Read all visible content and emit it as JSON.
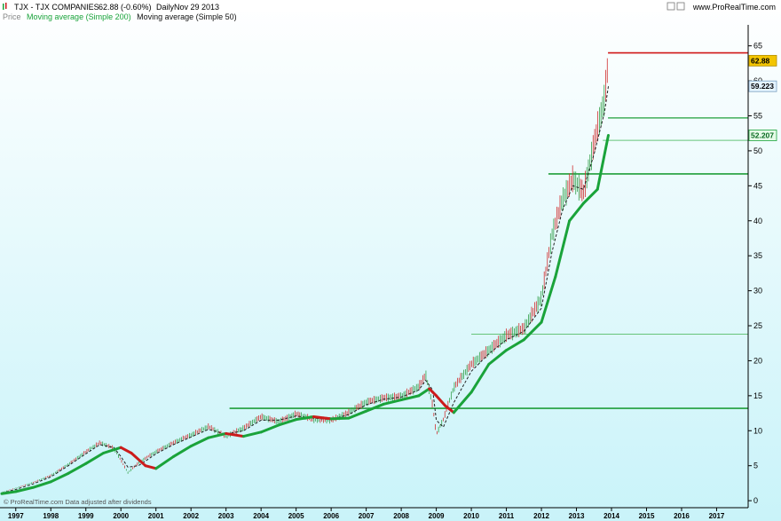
{
  "header": {
    "symbol": "TJX - TJX COMPANIES",
    "quote": "62.88 (-0.60%)",
    "period": "Daily",
    "date": "Nov 29 2013",
    "source": "www.ProRealTime.com"
  },
  "legend": {
    "price": "Price",
    "ma200": "Moving average (Simple 200)",
    "ma50": "Moving average (Simple 50)"
  },
  "watermark": "© ProRealTime.com Data adjusted after dividends",
  "colors": {
    "background_top": "#ffffff",
    "background_bottom": "#c9f3f9",
    "ma200_up": "#1aa33a",
    "ma200_down": "#cc1b1b",
    "ma50": "#222222",
    "price_up": "#33a04a",
    "price_down": "#d03030",
    "hline_strong": "#1f9e3a",
    "hline_light": "#66c47a",
    "hline_red": "#d01818",
    "badge_price": "#f3c500",
    "badge_ma50": "#e4f4ff",
    "badge_ma200": "#e6fbe8"
  },
  "chart_data": {
    "type": "line",
    "title": "TJX - TJX COMPANIES",
    "xlabel": "",
    "ylabel": "",
    "ylim": [
      -1,
      68
    ],
    "xlim": [
      1996.55,
      2017.9
    ],
    "y_ticks": [
      0,
      5,
      10,
      15,
      20,
      25,
      30,
      35,
      40,
      45,
      50,
      55,
      60,
      65
    ],
    "x_ticks": [
      "1997",
      "1998",
      "1999",
      "2000",
      "2001",
      "2002",
      "2003",
      "2004",
      "2005",
      "2006",
      "2007",
      "2008",
      "2009",
      "2010",
      "2011",
      "2012",
      "2013",
      "2014",
      "2015",
      "2016",
      "2017"
    ],
    "grid": false,
    "legend_position": "top-left",
    "series": [
      {
        "name": "Price",
        "x": [
          1996.6,
          1997.0,
          1997.5,
          1998.0,
          1998.5,
          1999.0,
          1999.4,
          1999.8,
          2000.0,
          2000.2,
          2000.5,
          2000.8,
          2001.0,
          2001.5,
          2002.0,
          2002.5,
          2003.0,
          2003.5,
          2004.0,
          2004.5,
          2005.0,
          2005.5,
          2006.0,
          2006.5,
          2007.0,
          2007.5,
          2008.0,
          2008.5,
          2008.7,
          2008.9,
          2009.0,
          2009.2,
          2009.5,
          2010.0,
          2010.5,
          2011.0,
          2011.5,
          2012.0,
          2012.3,
          2012.6,
          2012.9,
          2013.2,
          2013.5,
          2013.8,
          2013.91
        ],
        "values": [
          1.2,
          1.8,
          2.6,
          3.6,
          5.2,
          7.0,
          8.3,
          7.5,
          5.8,
          4.0,
          5.4,
          6.4,
          7.0,
          8.3,
          9.4,
          10.6,
          9.2,
          10.4,
          12.0,
          11.3,
          12.4,
          11.6,
          11.5,
          12.6,
          14.1,
          14.7,
          14.9,
          16.3,
          18.0,
          13.5,
          9.5,
          11.6,
          16.2,
          19.5,
          21.5,
          23.6,
          24.6,
          29.0,
          38.0,
          43.0,
          46.0,
          44.0,
          51.0,
          57.5,
          62.88
        ]
      },
      {
        "name": "Moving average (Simple 50)",
        "x": [
          1996.6,
          1997.0,
          1997.5,
          1998.0,
          1998.5,
          1999.0,
          1999.4,
          1999.8,
          2000.0,
          2000.2,
          2000.5,
          2000.8,
          2001.0,
          2001.5,
          2002.0,
          2002.5,
          2003.0,
          2003.5,
          2004.0,
          2004.5,
          2005.0,
          2005.5,
          2006.0,
          2006.5,
          2007.0,
          2007.5,
          2008.0,
          2008.5,
          2008.7,
          2008.9,
          2009.0,
          2009.2,
          2009.5,
          2010.0,
          2010.5,
          2011.0,
          2011.5,
          2012.0,
          2012.3,
          2012.6,
          2012.9,
          2013.2,
          2013.5,
          2013.8,
          2013.91
        ],
        "values": [
          1.1,
          1.6,
          2.4,
          3.4,
          5.0,
          6.7,
          8.0,
          7.6,
          6.3,
          4.8,
          5.0,
          6.0,
          6.7,
          8.0,
          9.1,
          10.2,
          9.5,
          10.0,
          11.5,
          11.5,
          12.1,
          11.8,
          11.6,
          12.3,
          13.7,
          14.5,
          14.8,
          15.8,
          17.2,
          15.8,
          11.5,
          10.5,
          14.0,
          18.5,
          21.0,
          23.0,
          24.2,
          27.5,
          35.5,
          41.5,
          45.0,
          44.5,
          49.5,
          55.5,
          59.223
        ]
      },
      {
        "name": "Moving average (Simple 200)",
        "x": [
          1996.6,
          1997.0,
          1997.5,
          1998.0,
          1998.5,
          1999.0,
          1999.5,
          2000.0,
          2000.3,
          2000.7,
          2001.0,
          2001.5,
          2002.0,
          2002.5,
          2003.0,
          2003.5,
          2004.0,
          2004.5,
          2005.0,
          2005.5,
          2006.0,
          2006.5,
          2007.0,
          2007.5,
          2008.0,
          2008.5,
          2008.8,
          2009.0,
          2009.25,
          2009.5,
          2010.0,
          2010.5,
          2011.0,
          2011.5,
          2012.0,
          2012.4,
          2012.8,
          2013.2,
          2013.6,
          2013.91
        ],
        "values": [
          1.0,
          1.3,
          1.9,
          2.7,
          3.9,
          5.3,
          6.8,
          7.6,
          6.8,
          5.0,
          4.6,
          6.3,
          7.8,
          9.0,
          9.6,
          9.2,
          9.8,
          10.8,
          11.6,
          12.0,
          11.7,
          11.8,
          12.8,
          13.8,
          14.4,
          15.0,
          16.0,
          15.0,
          13.6,
          12.6,
          15.5,
          19.5,
          21.5,
          23.0,
          25.5,
          32.0,
          40.0,
          42.5,
          44.5,
          52.207
        ]
      }
    ],
    "horizontal_lines": [
      {
        "y": 13.2,
        "x_start": 2003.1,
        "style": "strong"
      },
      {
        "y": 23.8,
        "x_start": 2010.0,
        "style": "light"
      },
      {
        "y": 46.7,
        "x_start": 2012.2,
        "style": "strong"
      },
      {
        "y": 51.5,
        "x_start": 2013.75,
        "style": "light"
      },
      {
        "y": 54.7,
        "x_start": 2013.9,
        "style": "medium"
      },
      {
        "y": 64.0,
        "x_start": 2013.9,
        "style": "red"
      }
    ],
    "value_labels": [
      {
        "key": "price",
        "text": "62.88",
        "y": 62.88
      },
      {
        "key": "ma50",
        "text": "59.223",
        "y": 59.223
      },
      {
        "key": "ma200",
        "text": "52.207",
        "y": 52.207
      }
    ]
  }
}
